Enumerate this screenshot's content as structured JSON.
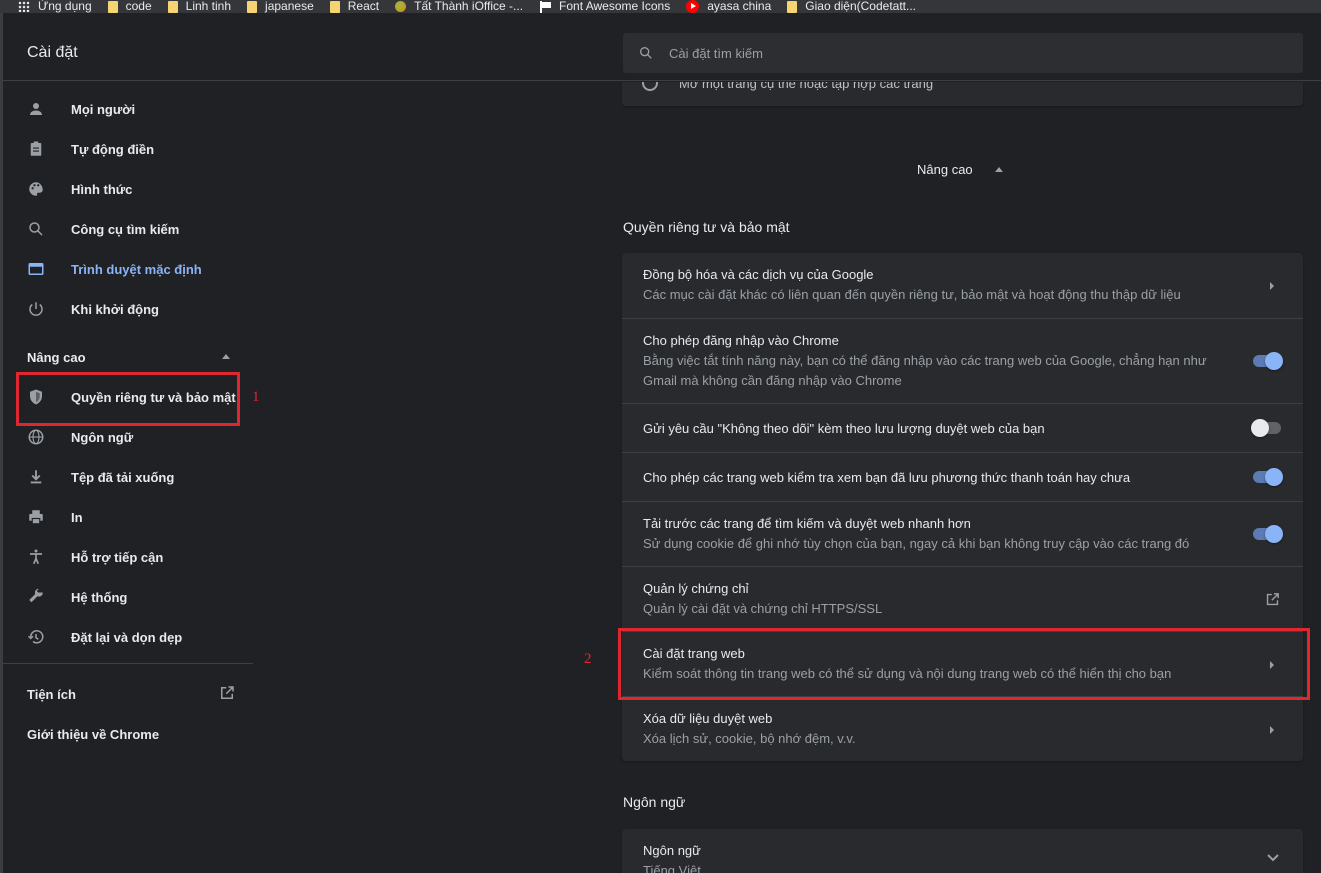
{
  "bookmarks": [
    {
      "label": "Ứng dụng",
      "icon": "apps-icon"
    },
    {
      "label": "code",
      "icon": "folder-icon"
    },
    {
      "label": "Linh tinh",
      "icon": "folder-icon"
    },
    {
      "label": "japanese",
      "icon": "folder-icon"
    },
    {
      "label": "React",
      "icon": "folder-icon"
    },
    {
      "label": "Tất Thành iOffice -...",
      "icon": "site-icon"
    },
    {
      "label": "Font Awesome Icons",
      "icon": "flag-icon"
    },
    {
      "label": "ayasa china",
      "icon": "youtube-icon"
    },
    {
      "label": "Giao diện(Codetatt...",
      "icon": "folder-icon"
    }
  ],
  "header": {
    "title": "Cài đặt",
    "search_placeholder": "Cài đặt tìm kiếm"
  },
  "sidebar": {
    "items": [
      {
        "label": "Mọi người",
        "icon": "person-icon"
      },
      {
        "label": "Tự động điền",
        "icon": "clipboard-icon"
      },
      {
        "label": "Hình thức",
        "icon": "palette-icon"
      },
      {
        "label": "Công cụ tìm kiếm",
        "icon": "search-icon"
      },
      {
        "label": "Trình duyệt mặc định",
        "icon": "browser-icon"
      },
      {
        "label": "Khi khởi động",
        "icon": "power-icon"
      }
    ],
    "advanced_label": "Nâng cao",
    "advanced_items": [
      {
        "label": "Quyền riêng tư và bảo mật",
        "icon": "shield-icon"
      },
      {
        "label": "Ngôn ngữ",
        "icon": "globe-icon"
      },
      {
        "label": "Tệp đã tải xuống",
        "icon": "download-icon"
      },
      {
        "label": "In",
        "icon": "printer-icon"
      },
      {
        "label": "Hỗ trợ tiếp cận",
        "icon": "accessibility-icon"
      },
      {
        "label": "Hệ thống",
        "icon": "wrench-icon"
      },
      {
        "label": "Đặt lại và dọn dẹp",
        "icon": "restore-icon"
      }
    ],
    "extensions_label": "Tiện ích",
    "about_label": "Giới thiệu về Chrome"
  },
  "annotations": {
    "one": "1",
    "two": "2"
  },
  "main": {
    "top_partial_text": "Mở một trang cụ thể hoặc tập hợp các trang",
    "advanced_toggle": "Nâng cao",
    "privacy_title": "Quyền riêng tư và bảo mật",
    "privacy_rows": [
      {
        "title": "Đồng bộ hóa và các dịch vụ của Google",
        "subtitle": "Các mục cài đặt khác có liên quan đến quyền riêng tư, bảo mật và hoạt động thu thập dữ liệu",
        "control": "chevron"
      },
      {
        "title": "Cho phép đăng nhập vào Chrome",
        "subtitle": "Bằng việc tắt tính năng này, bạn có thể đăng nhập vào các trang web của Google, chẳng hạn như Gmail mà không cần đăng nhập vào Chrome",
        "control": "toggle",
        "on": true
      },
      {
        "title": "Gửi yêu cầu \"Không theo dõi\" kèm theo lưu lượng duyệt web của bạn",
        "subtitle": "",
        "control": "toggle",
        "on": false
      },
      {
        "title": "Cho phép các trang web kiểm tra xem bạn đã lưu phương thức thanh toán hay chưa",
        "subtitle": "",
        "control": "toggle",
        "on": true
      },
      {
        "title": "Tải trước các trang để tìm kiếm và duyệt web nhanh hơn",
        "subtitle": "Sử dụng cookie để ghi nhớ tùy chọn của bạn, ngay cả khi bạn không truy cập vào các trang đó",
        "control": "toggle",
        "on": true
      },
      {
        "title": "Quản lý chứng chỉ",
        "subtitle": "Quản lý cài đặt và chứng chỉ HTTPS/SSL",
        "control": "external"
      },
      {
        "title": "Cài đặt trang web",
        "subtitle": "Kiểm soát thông tin trang web có thể sử dụng và nội dung trang web có thể hiển thị cho bạn",
        "control": "chevron"
      },
      {
        "title": "Xóa dữ liệu duyệt web",
        "subtitle": "Xóa lịch sử, cookie, bộ nhớ đệm, v.v.",
        "control": "chevron"
      }
    ],
    "language_title": "Ngôn ngữ",
    "language_row": {
      "title": "Ngôn ngữ",
      "subtitle": "Tiếng Việt"
    }
  },
  "colors": {
    "accent": "#8ab4f8",
    "annotation": "#e0262f",
    "background": "#202124",
    "card": "#292a2d"
  }
}
